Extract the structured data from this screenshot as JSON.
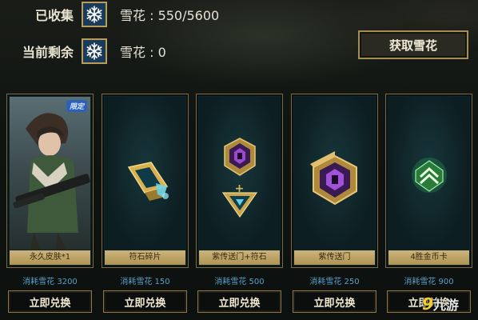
{
  "stats": {
    "collected_label": "已收集",
    "collected_value": "雪花 : 550/5600",
    "remaining_label": "当前剩余",
    "remaining_value": "雪花 : 0",
    "icon": "snowflake-icon",
    "icon_bg": "#1a3b58"
  },
  "get_button": {
    "label": "获取雪花"
  },
  "cards": [
    {
      "name": "永久皮肤*1",
      "cost": "消耗雪花 3200",
      "button": "立即兑换",
      "art": "hero-skin-portrait",
      "badge": "限定"
    },
    {
      "name": "符石碎片",
      "cost": "消耗雪花 150",
      "button": "立即兑换",
      "art": "rune-shard-icon"
    },
    {
      "name": "紫传送门+符石",
      "cost": "消耗雪花 500",
      "button": "立即兑换",
      "art": "portal-and-rune-icon"
    },
    {
      "name": "紫传送门",
      "cost": "消耗雪花 250",
      "button": "立即兑换",
      "art": "purple-portal-icon"
    },
    {
      "name": "4胜金币卡",
      "cost": "消耗雪花 900",
      "button": "立即兑换",
      "art": "gold-card-icon"
    }
  ],
  "watermark": {
    "nine": "9",
    "text": "九游"
  },
  "colors": {
    "gold_border": "#b89c5e",
    "card_bg": "#0f2226",
    "name_bar": "#cbb37c",
    "cost_text": "#5aa0c6"
  }
}
